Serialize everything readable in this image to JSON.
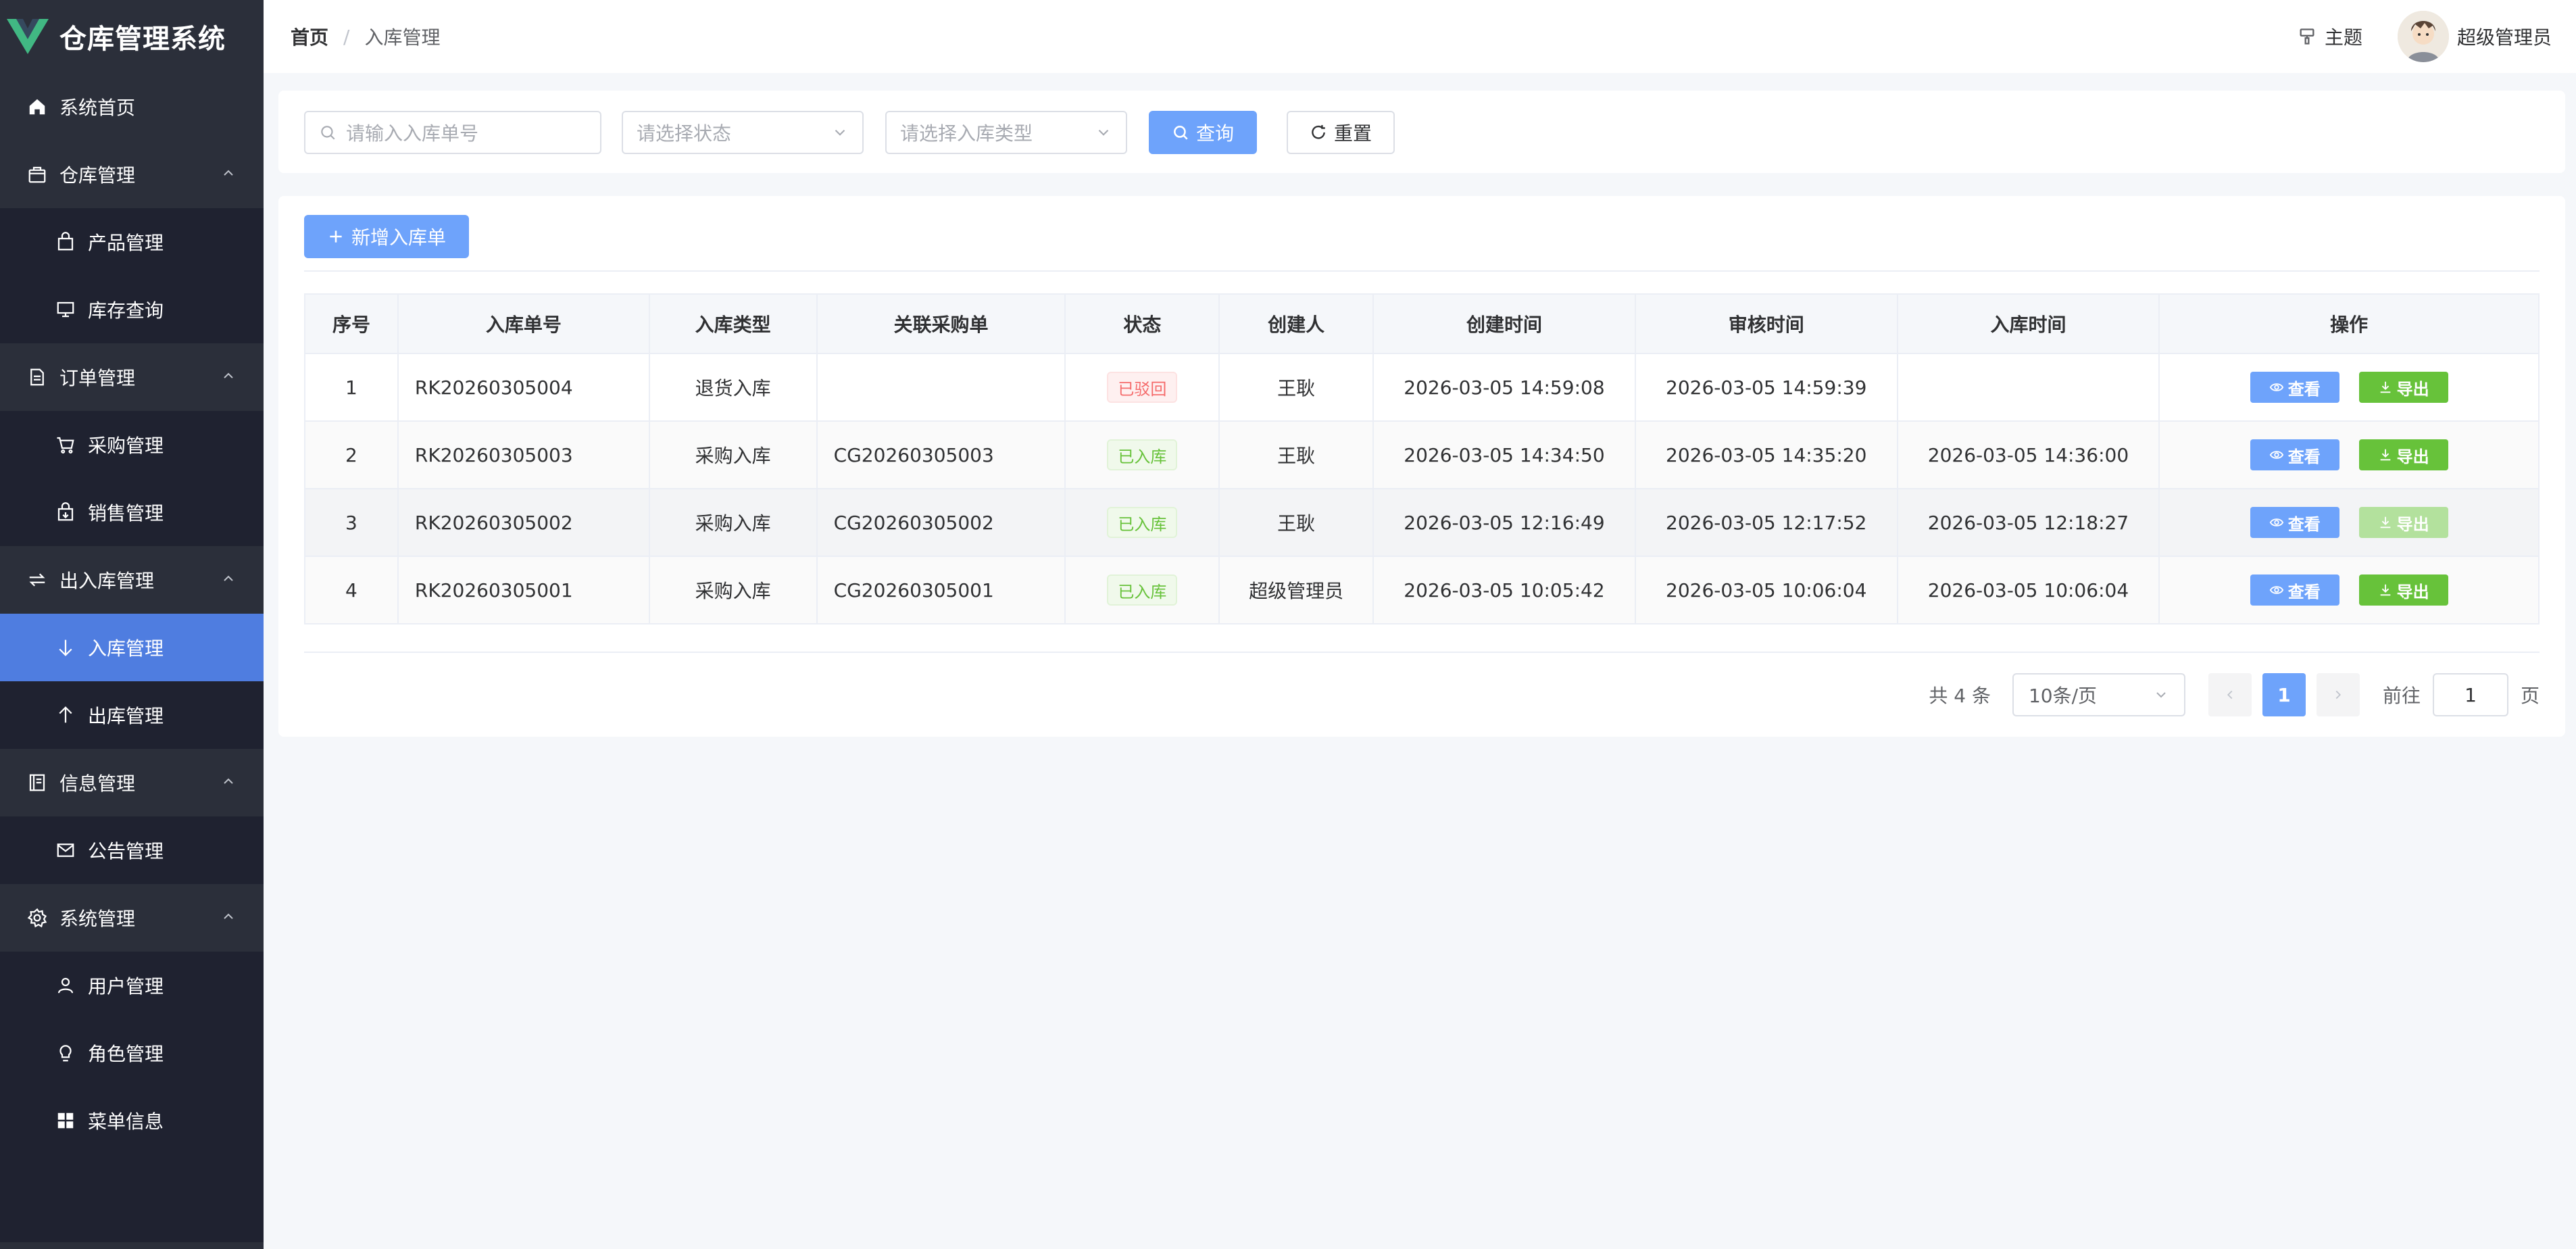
{
  "app": {
    "title": "仓库管理系统"
  },
  "sidebar": {
    "items": [
      {
        "label": "系统首页"
      },
      {
        "label": "仓库管理",
        "children": [
          {
            "label": "产品管理"
          },
          {
            "label": "库存查询"
          }
        ]
      },
      {
        "label": "订单管理",
        "children": [
          {
            "label": "采购管理"
          },
          {
            "label": "销售管理"
          }
        ]
      },
      {
        "label": "出入库管理",
        "children": [
          {
            "label": "入库管理"
          },
          {
            "label": "出库管理"
          }
        ]
      },
      {
        "label": "信息管理",
        "children": [
          {
            "label": "公告管理"
          }
        ]
      },
      {
        "label": "系统管理",
        "children": [
          {
            "label": "用户管理"
          },
          {
            "label": "角色管理"
          },
          {
            "label": "菜单信息"
          }
        ]
      }
    ],
    "active": "入库管理",
    "active_color": "#4f7de0",
    "bg_color": "#2b2f3a"
  },
  "header": {
    "breadcrumb_home": "首页",
    "breadcrumb_sep": "/",
    "breadcrumb_current": "入库管理",
    "theme_label": "主题",
    "user_name": "超级管理员"
  },
  "search": {
    "order_no_placeholder": "请输入入库单号",
    "status_placeholder": "请选择状态",
    "type_placeholder": "请选择入库类型",
    "query_label": "查询",
    "reset_label": "重置"
  },
  "toolbar": {
    "add_label": "新增入库单"
  },
  "table": {
    "columns": [
      "序号",
      "入库单号",
      "入库类型",
      "关联采购单",
      "状态",
      "创建人",
      "创建时间",
      "审核时间",
      "入库时间",
      "操作"
    ],
    "rows": [
      {
        "index": "1",
        "no": "RK20260305004",
        "type": "退货入库",
        "po": "",
        "status": "已驳回",
        "status_kind": "danger",
        "creator": "王耿",
        "created": "2026-03-05 14:59:08",
        "audited": "2026-03-05 14:59:39",
        "stocked": "",
        "view": "查看",
        "export": "导出",
        "export_disabled": false
      },
      {
        "index": "2",
        "no": "RK20260305003",
        "type": "采购入库",
        "po": "CG20260305003",
        "status": "已入库",
        "status_kind": "success",
        "creator": "王耿",
        "created": "2026-03-05 14:34:50",
        "audited": "2026-03-05 14:35:20",
        "stocked": "2026-03-05 14:36:00",
        "view": "查看",
        "export": "导出",
        "export_disabled": false
      },
      {
        "index": "3",
        "no": "RK20260305002",
        "type": "采购入库",
        "po": "CG20260305002",
        "status": "已入库",
        "status_kind": "success",
        "creator": "王耿",
        "created": "2026-03-05 12:16:49",
        "audited": "2026-03-05 12:17:52",
        "stocked": "2026-03-05 12:18:27",
        "view": "查看",
        "export": "导出",
        "export_disabled": true
      },
      {
        "index": "4",
        "no": "RK20260305001",
        "type": "采购入库",
        "po": "CG20260305001",
        "status": "已入库",
        "status_kind": "success",
        "creator": "超级管理员",
        "created": "2026-03-05 10:05:42",
        "audited": "2026-03-05 10:06:04",
        "stocked": "2026-03-05 10:06:04",
        "view": "查看",
        "export": "导出",
        "export_disabled": false
      }
    ]
  },
  "pagination": {
    "total_text": "共 4 条",
    "page_size": "10条/页",
    "current_page": "1",
    "goto_label": "前往",
    "goto_value": "1",
    "page_suffix": "页"
  },
  "icons": {
    "logo": "vue-logo-icon",
    "home": "home-icon",
    "warehouse": "bag-icon",
    "order": "document-icon",
    "inout": "switch-icon",
    "info": "notebook-icon",
    "system": "gear-icon"
  },
  "colors": {
    "primary": "#6ea3fb",
    "success": "#67c23a",
    "danger": "#f56c6c"
  }
}
